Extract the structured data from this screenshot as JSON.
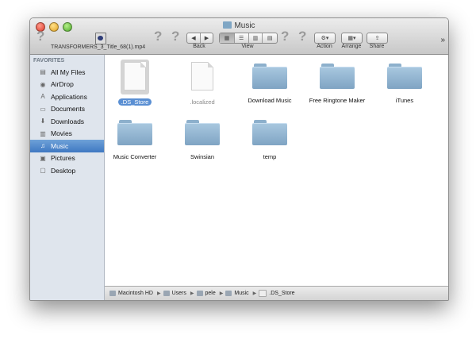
{
  "window": {
    "title": "Music"
  },
  "toolbar": {
    "recent_file": "TRANSFORMERS_3_Title_68(1).mp4",
    "back_label": "Back",
    "view_label": "View",
    "action_label": "Action",
    "arrange_label": "Arrange",
    "share_label": "Share",
    "overflow": "»"
  },
  "sidebar": {
    "heading": "FAVORITES",
    "items": [
      {
        "label": "All My Files",
        "icon": "all-files-icon"
      },
      {
        "label": "AirDrop",
        "icon": "airdrop-icon"
      },
      {
        "label": "Applications",
        "icon": "applications-icon"
      },
      {
        "label": "Documents",
        "icon": "documents-icon"
      },
      {
        "label": "Downloads",
        "icon": "downloads-icon"
      },
      {
        "label": "Movies",
        "icon": "movies-icon"
      },
      {
        "label": "Music",
        "icon": "music-icon",
        "selected": true
      },
      {
        "label": "Pictures",
        "icon": "pictures-icon"
      },
      {
        "label": "Desktop",
        "icon": "desktop-icon"
      }
    ]
  },
  "files": [
    {
      "label": ".DS_Store",
      "kind": "document",
      "selected": true
    },
    {
      "label": ".localized",
      "kind": "document"
    },
    {
      "label": "Download Music",
      "kind": "folder"
    },
    {
      "label": "Free Ringtone Maker",
      "kind": "folder"
    },
    {
      "label": "iTunes",
      "kind": "folder"
    },
    {
      "label": "Music Converter",
      "kind": "folder"
    },
    {
      "label": "Swinsian",
      "kind": "folder"
    },
    {
      "label": "temp",
      "kind": "folder"
    }
  ],
  "path": [
    "Macintosh HD",
    "Users",
    "pele",
    "Music",
    ".DS_Store"
  ],
  "colors": {
    "selection": "#3f78c2",
    "sidebar": "#dfe5ed",
    "folder": "#8db0cc"
  }
}
